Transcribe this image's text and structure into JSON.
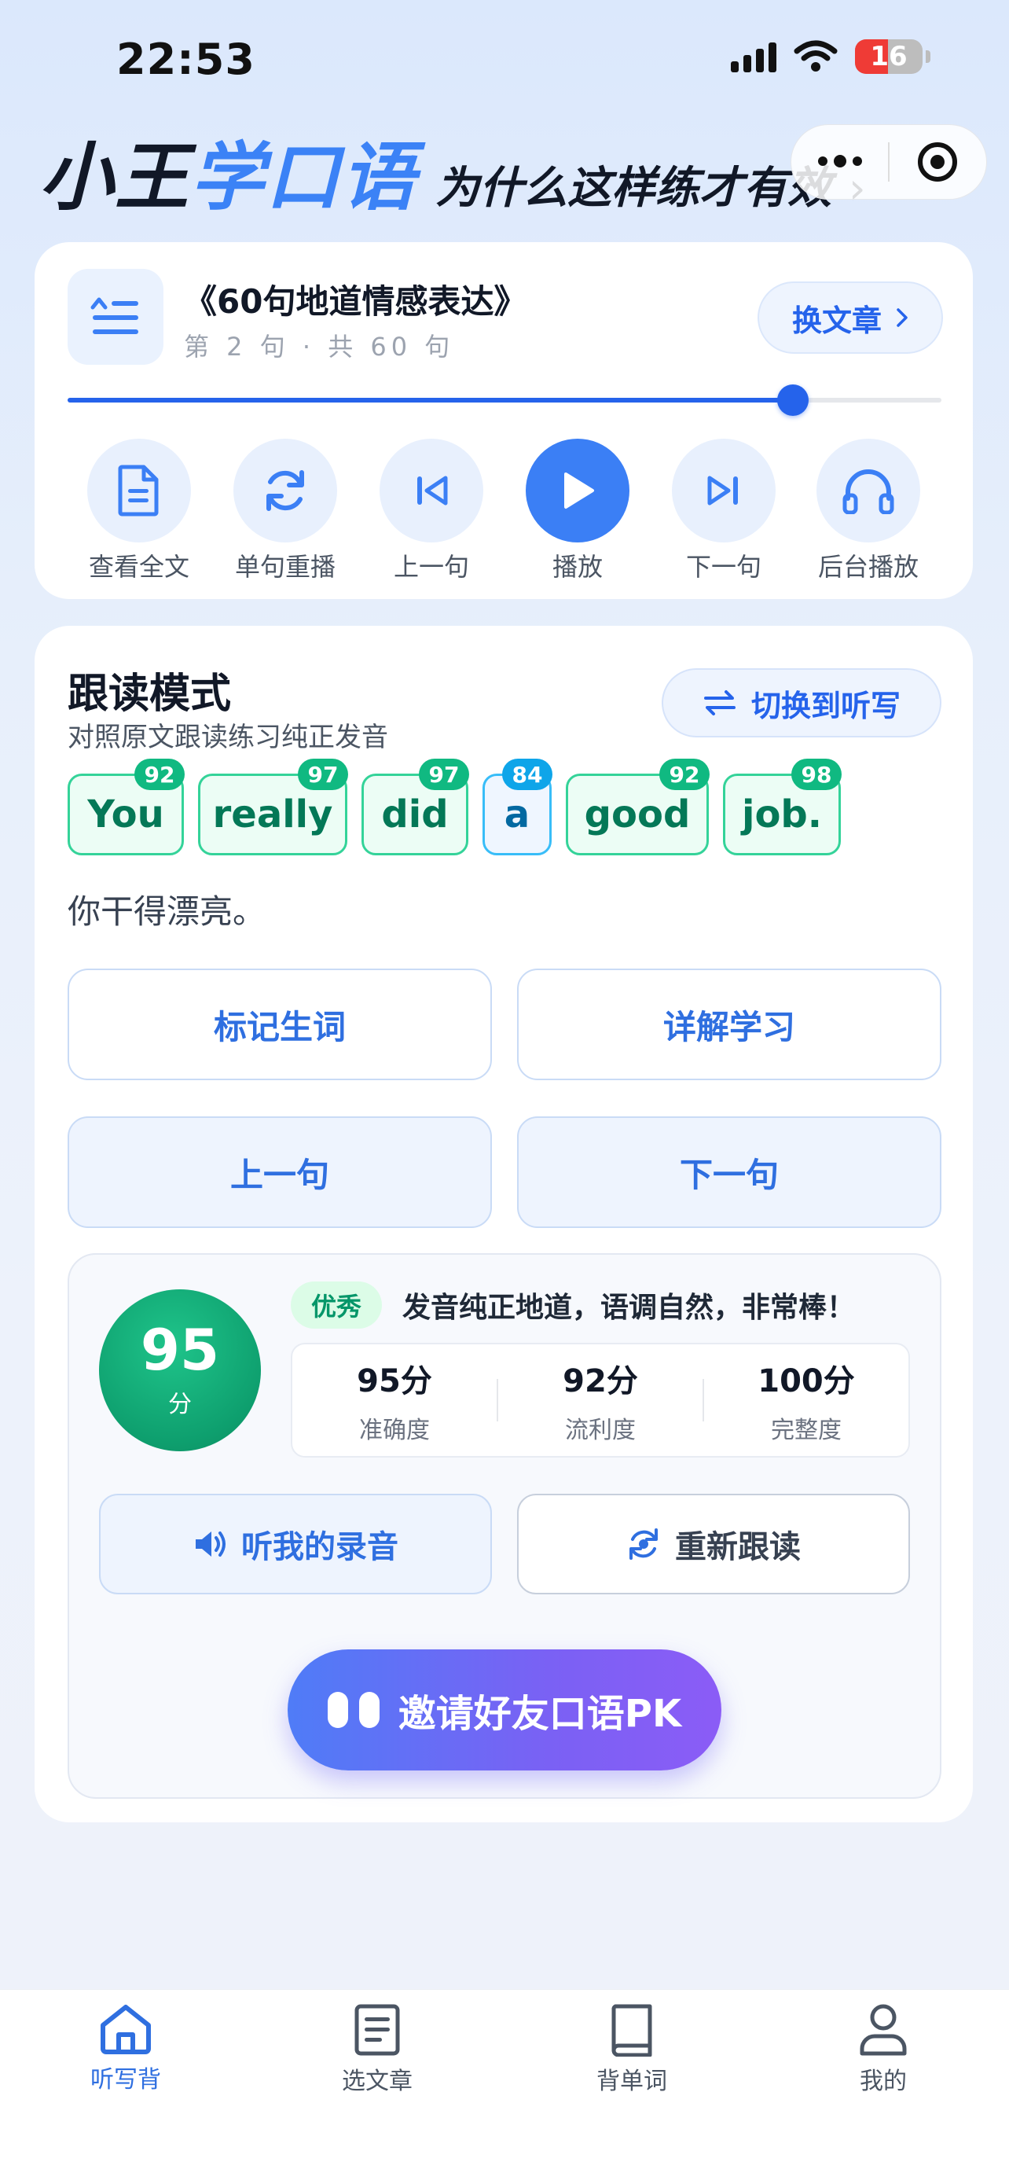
{
  "status": {
    "time": "22:53",
    "battery": "16"
  },
  "header": {
    "brand_main": "小王",
    "brand_accent": "学口语",
    "tagline": "为什么这样练才有效",
    "chevron": "›"
  },
  "article": {
    "title": "《60句地道情感表达》",
    "position": "第 2 句 · 共 60 句",
    "switch_label": "换文章",
    "progress": 0.83
  },
  "controls": [
    {
      "label": "查看全文",
      "icon": "document-icon"
    },
    {
      "label": "单句重播",
      "icon": "repeat-icon"
    },
    {
      "label": "上一句",
      "icon": "skip-back-icon"
    },
    {
      "label": "播放",
      "icon": "play-icon"
    },
    {
      "label": "下一句",
      "icon": "skip-forward-icon"
    },
    {
      "label": "后台播放",
      "icon": "headphones-icon"
    }
  ],
  "mode": {
    "title": "跟读模式",
    "subtitle": "对照原文跟读练习纯正发音",
    "switch_label": "切换到听写"
  },
  "sentence": {
    "words": [
      {
        "text": "You",
        "score": "92"
      },
      {
        "text": "really",
        "score": "97"
      },
      {
        "text": "did",
        "score": "97"
      },
      {
        "text": "a",
        "score": "84"
      },
      {
        "text": "good",
        "score": "92"
      },
      {
        "text": "job.",
        "score": "98"
      }
    ],
    "translation": "你干得漂亮。"
  },
  "actions": {
    "mark_word": "标记生词",
    "detail_study": "详解学习",
    "prev_sentence": "上一句",
    "next_sentence": "下一句"
  },
  "score": {
    "total": "95",
    "unit": "分",
    "grade": "优秀",
    "comment": "发音纯正地道，语调自然，非常棒！",
    "metrics": [
      {
        "value": "95分",
        "label": "准确度"
      },
      {
        "value": "92分",
        "label": "流利度"
      },
      {
        "value": "100分",
        "label": "完整度"
      }
    ],
    "listen_label": "听我的录音",
    "reread_label": "重新跟读"
  },
  "invite": {
    "label": "邀请好友口语PK"
  },
  "tabs": [
    {
      "label": "听写背",
      "active": true
    },
    {
      "label": "选文章",
      "active": false
    },
    {
      "label": "背单词",
      "active": false
    },
    {
      "label": "我的",
      "active": false
    }
  ],
  "colors": {
    "accent": "#2f6fe0",
    "primary_blue": "#3b7ff5",
    "success": "#10b981",
    "word_blue": "#0ea5e9"
  }
}
